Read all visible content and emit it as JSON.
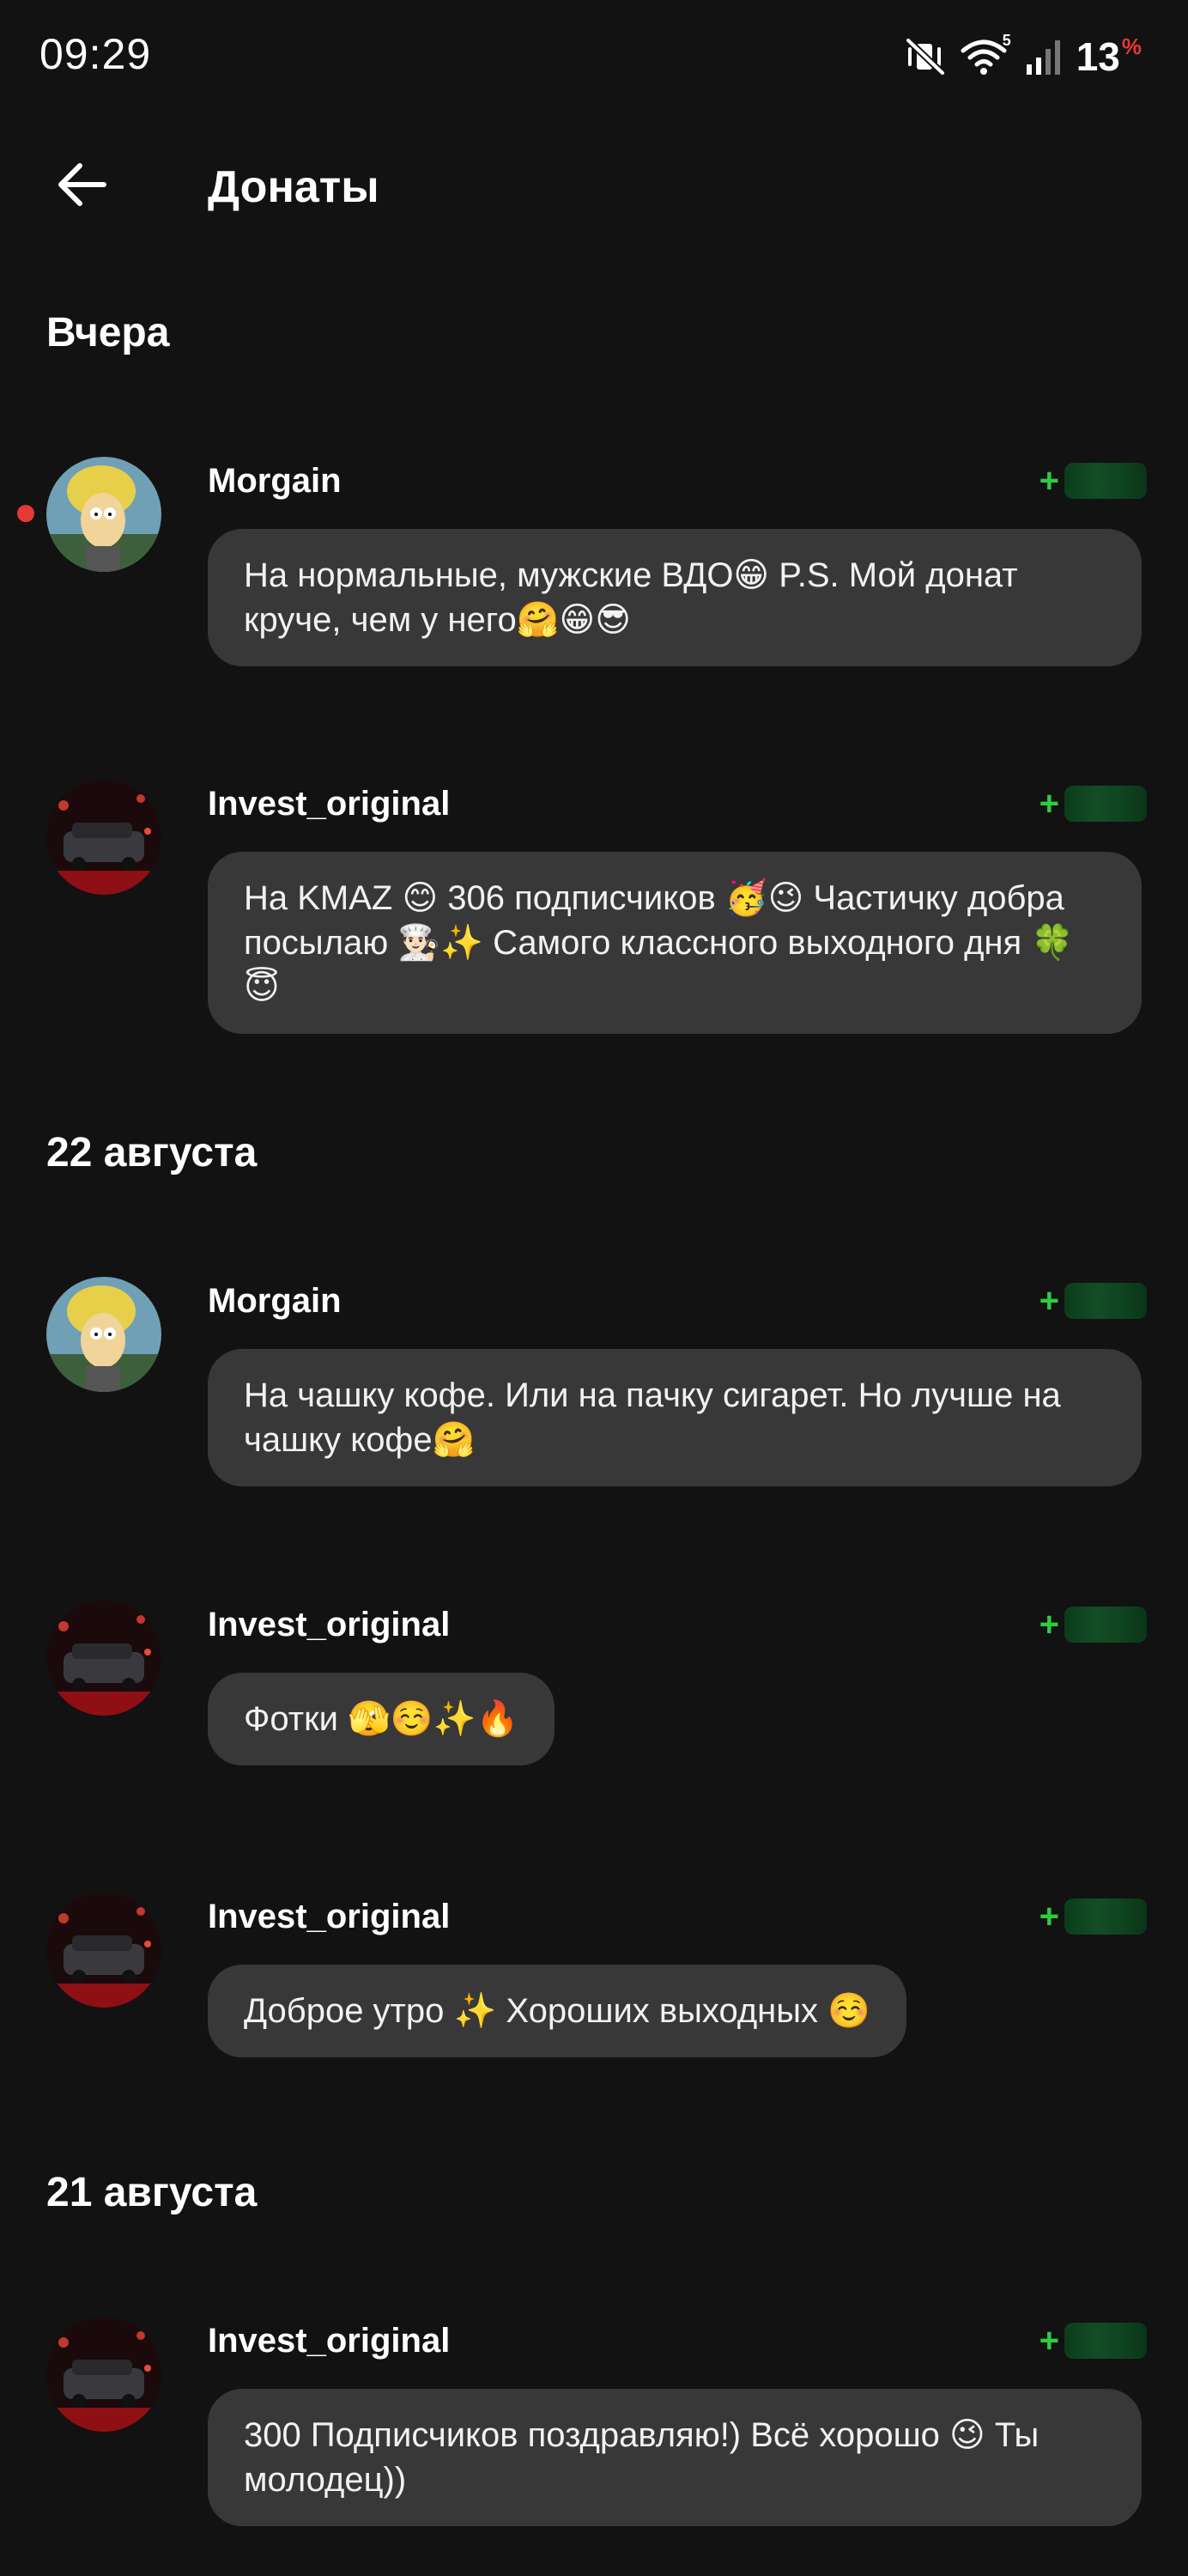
{
  "status_bar": {
    "time": "09:29",
    "battery": "13",
    "battery_unit": "%",
    "wifi_label": "5"
  },
  "header": {
    "title": "Донаты"
  },
  "sections": [
    {
      "title": "Вчера",
      "donations": [
        {
          "sender": "Morgain",
          "amount_prefix": "+",
          "message": "На нормальные, мужские ВДО😁 P.S. Мой донат круче, чем у него🤗😁😎",
          "unread": true
        },
        {
          "sender": "Invest_original",
          "amount_prefix": "+",
          "message": "На KMAZ 😊  306 подписчиков 🥳😉  Частичку добра посылаю 👨🏻‍🍳✨  Самого классного выходного дня 🍀😇",
          "unread": false
        }
      ]
    },
    {
      "title": "22 августа",
      "donations": [
        {
          "sender": "Morgain",
          "amount_prefix": "+",
          "message": "На чашку кофе. Или на пачку сигарет. Но лучше на чашку кофе🤗",
          "unread": false
        },
        {
          "sender": "Invest_original",
          "amount_prefix": "+",
          "message": "Фотки 🫣☺️✨🔥",
          "unread": false
        },
        {
          "sender": "Invest_original",
          "amount_prefix": "+",
          "message": "Доброе утро ✨ Хороших выходных ☺️",
          "unread": false
        }
      ]
    },
    {
      "title": "21 августа",
      "donations": [
        {
          "sender": "Invest_original",
          "amount_prefix": "+",
          "message": "300 Подписчиков поздравляю!) Всё хорошо 😉 Ты молодец))",
          "unread": false
        }
      ]
    }
  ],
  "icons": {
    "back": "arrow-left-icon",
    "mute": "vibrate-mute-icon",
    "wifi": "wifi-icon",
    "signal": "signal-icon",
    "avatar_morgain": "cartoon-avatar",
    "avatar_invest": "car-avatar"
  },
  "colors": {
    "background": "#121212",
    "bubble": "#383838",
    "amount_accent": "#2ecc40",
    "unread_dot": "#e53935",
    "battery_percent": "#e53935"
  }
}
